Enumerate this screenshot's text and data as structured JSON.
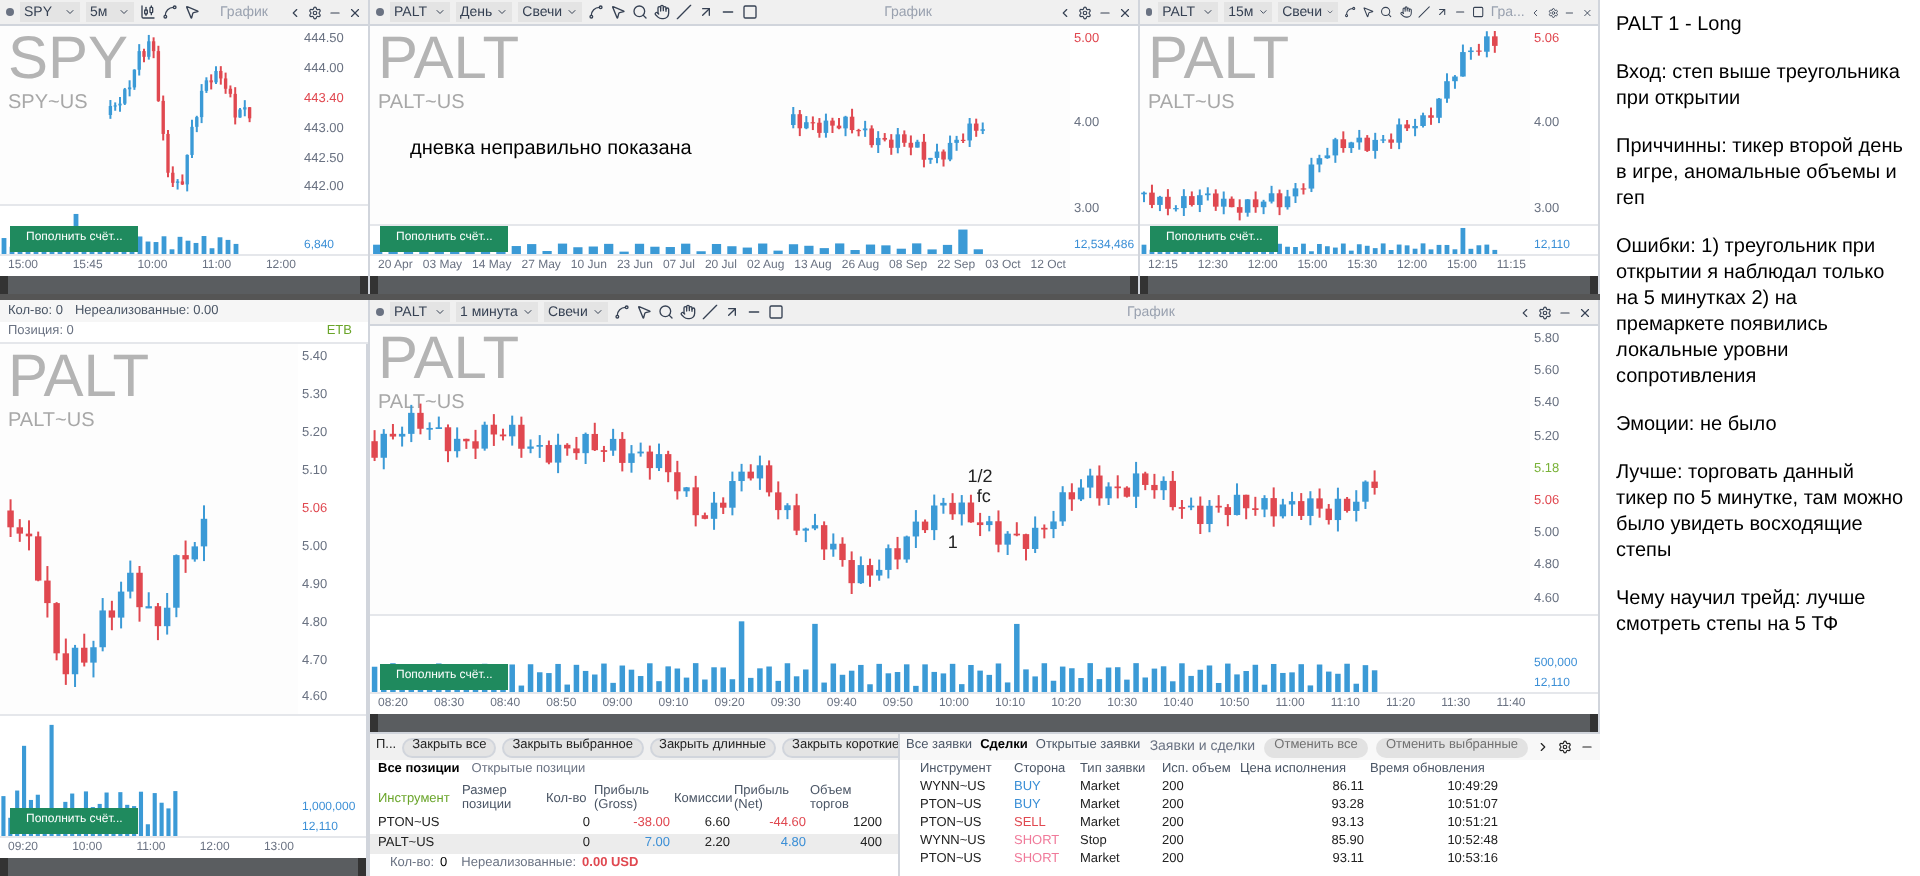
{
  "spy_chart": {
    "toolbar": {
      "symbol": "SPY",
      "timeframe": "5м",
      "title": "График"
    },
    "watermark": "SPY",
    "watermark_sub": "SPY~US",
    "price_ticks": [
      {
        "label": "444.50",
        "kind": "tick"
      },
      {
        "label": "444.00",
        "kind": "tick"
      },
      {
        "label": "443.40",
        "kind": "last"
      },
      {
        "label": "443.00",
        "kind": "tick"
      },
      {
        "label": "442.50",
        "kind": "tick"
      },
      {
        "label": "442.00",
        "kind": "tick"
      }
    ],
    "volume_ticks": [
      "6,840"
    ],
    "time_ticks": [
      "15:00",
      "15:45",
      "10:00",
      "11:00",
      "12:00"
    ],
    "button": "Пополнить счёт..."
  },
  "day_chart": {
    "toolbar": {
      "symbol": "PALT",
      "timeframe": "День",
      "chart_type": "Свечи",
      "title": "График"
    },
    "watermark": "PALT",
    "watermark_sub": "PALT~US",
    "annotation": "дневка неправильно показана",
    "price_ticks": [
      {
        "label": "5.00",
        "kind": "last"
      },
      {
        "label": "4.00",
        "kind": "tick"
      },
      {
        "label": "3.00",
        "kind": "tick"
      }
    ],
    "volume_ticks": [
      "12,534,486"
    ],
    "time_ticks": [
      "20 Apr",
      "03 May",
      "14 May",
      "27 May",
      "10 Jun",
      "23 Jun",
      "07 Jul",
      "20 Jul",
      "02 Aug",
      "13 Aug",
      "26 Aug",
      "08 Sep",
      "22 Sep",
      "03 Oct",
      "12 Oct"
    ],
    "button": "Пополнить счёт..."
  },
  "m15_chart": {
    "toolbar": {
      "symbol": "PALT",
      "timeframe": "15м",
      "chart_type": "Свечи",
      "title": "Гра..."
    },
    "watermark": "PALT",
    "watermark_sub": "PALT~US",
    "price_ticks": [
      {
        "label": "5.06",
        "kind": "last"
      },
      {
        "label": "4.00",
        "kind": "tick"
      },
      {
        "label": "3.00",
        "kind": "tick"
      }
    ],
    "volume_ticks": [
      "12,110"
    ],
    "time_ticks": [
      "12:15",
      "12:30",
      "12:00",
      "15:00",
      "15:30",
      "12:00",
      "15:00",
      "11:15"
    ],
    "button": "Пополнить счёт..."
  },
  "position_bar": {
    "quantity": "Кол-во: 0",
    "unrealized": "Нереализованные: 0.00",
    "position": "Позиция: 0",
    "badge": "ETB"
  },
  "m5_chart": {
    "watermark": "PALT",
    "watermark_sub": "PALT~US",
    "price_ticks": [
      {
        "label": "5.40",
        "kind": "tick"
      },
      {
        "label": "5.30",
        "kind": "tick"
      },
      {
        "label": "5.20",
        "kind": "tick"
      },
      {
        "label": "5.10",
        "kind": "tick"
      },
      {
        "label": "5.06",
        "kind": "last"
      },
      {
        "label": "5.00",
        "kind": "tick"
      },
      {
        "label": "4.90",
        "kind": "tick"
      },
      {
        "label": "4.80",
        "kind": "tick"
      },
      {
        "label": "4.70",
        "kind": "tick"
      },
      {
        "label": "4.60",
        "kind": "tick"
      }
    ]
  },
  "volume_chart": {
    "volume_ticks": [
      "1,000,000",
      "12,110"
    ],
    "time_ticks": [
      "09:20",
      "10:00",
      "11:00",
      "12:00",
      "13:00"
    ],
    "button": "Пополнить счёт..."
  },
  "main_chart": {
    "toolbar": {
      "symbol": "PALT",
      "timeframe": "1 минута",
      "chart_type": "Свечи",
      "title": "График"
    },
    "watermark": "PALT",
    "watermark_sub": "PALT~US",
    "annotations": [
      "1/2",
      "fc",
      "1"
    ],
    "price_ticks": [
      {
        "label": "5.80",
        "kind": "tick"
      },
      {
        "label": "5.60",
        "kind": "tick"
      },
      {
        "label": "5.40",
        "kind": "tick"
      },
      {
        "label": "5.20",
        "kind": "tick"
      },
      {
        "label": "5.18",
        "kind": "level"
      },
      {
        "label": "5.06",
        "kind": "last"
      },
      {
        "label": "5.00",
        "kind": "tick"
      },
      {
        "label": "4.80",
        "kind": "tick"
      },
      {
        "label": "4.60",
        "kind": "tick"
      }
    ],
    "volume_ticks": [
      "500,000",
      "12,110"
    ],
    "time_ticks": [
      "08:20",
      "08:30",
      "08:40",
      "08:50",
      "09:00",
      "09:10",
      "09:20",
      "09:30",
      "09:40",
      "09:50",
      "10:00",
      "10:10",
      "10:20",
      "10:30",
      "10:40",
      "10:50",
      "11:00",
      "11:10",
      "11:20",
      "11:30",
      "11:40"
    ],
    "button": "Пополнить счёт..."
  },
  "positions": {
    "tab": "П...",
    "buttons": [
      "Закрыть все",
      "Закрыть выбранное",
      "Закрыть длинные",
      "Закрыть короткие"
    ],
    "tabs": [
      {
        "label": "Все позиции",
        "selected": true
      },
      {
        "label": "Открытые позиции",
        "selected": false
      }
    ],
    "columns": [
      "Инструмент",
      "Размер позиции",
      "Кол-во",
      "Прибыль (Gross)",
      "Комиссии",
      "Прибыль (Net)",
      "Объем торгов"
    ],
    "rows": [
      {
        "instrument": "PTON~US",
        "quantity": "0",
        "gross": {
          "text": "-38.00",
          "color": "#e04850"
        },
        "commission": "6.60",
        "net": {
          "text": "-44.60",
          "color": "#e04850"
        },
        "volume": "1200",
        "selected": false
      },
      {
        "instrument": "PALT~US",
        "quantity": "0",
        "gross": {
          "text": "7.00",
          "color": "#3b8fd6"
        },
        "commission": "2.20",
        "net": {
          "text": "4.80",
          "color": "#3b8fd6"
        },
        "volume": "400",
        "selected": true
      }
    ],
    "footer_count_label": "Кол-во:",
    "footer_count": "0",
    "footer_unrealized_label": "Нереализованные:",
    "footer_unrealized": "0.00 USD"
  },
  "orders": {
    "tabs": [
      {
        "label": "Все заявки",
        "selected": false
      },
      {
        "label": "Сделки",
        "selected": true
      },
      {
        "label": "Открытые заявки",
        "selected": false
      }
    ],
    "title": "Заявки и сделки",
    "buttons": [
      {
        "label": "Отменить все",
        "disabled": true
      },
      {
        "label": "Отменить выбранные",
        "disabled": true
      }
    ],
    "columns": [
      "Инструмент",
      "Сторона",
      "Тип заявки",
      "Исп. объем",
      "Цена исполнения",
      "Время обновления"
    ],
    "rows": [
      {
        "instrument": "WYNN~US",
        "side": "BUY",
        "color": "#3b8fd6",
        "type": "Market",
        "quantity": "200",
        "price": "86.11",
        "time": "10:49:29"
      },
      {
        "instrument": "PTON~US",
        "side": "BUY",
        "color": "#3b8fd6",
        "type": "Market",
        "quantity": "200",
        "price": "93.28",
        "time": "10:51:07"
      },
      {
        "instrument": "PTON~US",
        "side": "SELL",
        "color": "#e04850",
        "type": "Market",
        "quantity": "200",
        "price": "93.13",
        "time": "10:51:21"
      },
      {
        "instrument": "WYNN~US",
        "side": "SHORT",
        "color": "#f07a9a",
        "type": "Stop",
        "quantity": "200",
        "price": "85.90",
        "time": "10:52:48"
      },
      {
        "instrument": "PTON~US",
        "side": "SHORT",
        "color": "#f07a9a",
        "type": "Market",
        "quantity": "200",
        "price": "93.11",
        "time": "10:53:16"
      }
    ]
  },
  "notes": {
    "title": "PALT 1 - Long",
    "paragraphs": [
      "Вход: степ выше треугольника при открытии",
      "Приччинны: тикер второй день в  игре, аномальные объемы и геп",
      "Ошибки: 1) треугольник при открытии я наблюдал только на 5 минутках  2) на премаркете появились локальные уровни сопротивления",
      "Эмоции: не было",
      "Лучше: торговать данный тикер по 5 минутке, там можно было увидеть восходящие степы",
      "Чему научил трейд: лучше смотреть степы на 5 ТФ"
    ]
  }
}
